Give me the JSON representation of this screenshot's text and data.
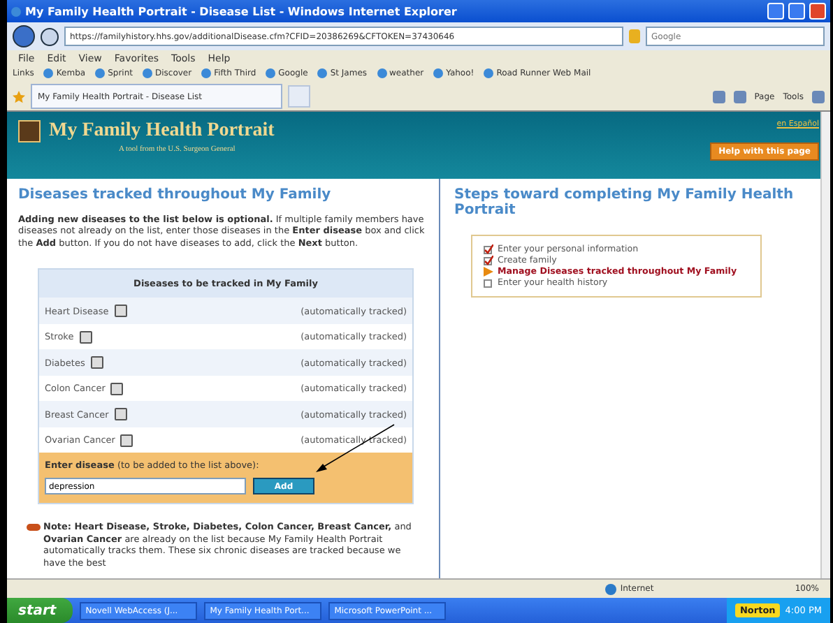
{
  "window": {
    "title": "My Family Health Portrait - Disease List - Windows Internet Explorer"
  },
  "address": {
    "url": "https://familyhistory.hhs.gov/additionalDisease.cfm?CFID=20386269&CFTOKEN=37430646",
    "search_placeholder": "Google"
  },
  "menu": [
    "File",
    "Edit",
    "View",
    "Favorites",
    "Tools",
    "Help"
  ],
  "links": {
    "label": "Links",
    "items": [
      "Kemba",
      "Sprint",
      "Discover",
      "Fifth Third",
      "Google",
      "St James",
      "weather",
      "Yahoo!",
      "Road Runner Web Mail"
    ]
  },
  "tab": {
    "label": "My Family Health Portrait - Disease List"
  },
  "toolbar": [
    "Page",
    "Tools"
  ],
  "header": {
    "title": "My Family Health Portrait",
    "subtitle": "A tool from the U.S. Surgeon General",
    "language_link": "en Español",
    "help_button": "Help with this page"
  },
  "left": {
    "heading": "Diseases tracked throughout My Family",
    "intro": "**Adding new diseases to the list below is optional.** If multiple family members have diseases not already on the list, enter those diseases in the **Enter disease** box and click the **Add** button. If you do not have diseases to add, click the **Next** button.",
    "table_header": "Diseases to be tracked in My Family",
    "rows": [
      {
        "name": "Heart Disease",
        "status": "(automatically tracked)"
      },
      {
        "name": "Stroke",
        "status": "(automatically tracked)"
      },
      {
        "name": "Diabetes",
        "status": "(automatically tracked)"
      },
      {
        "name": "Colon Cancer",
        "status": "(automatically tracked)"
      },
      {
        "name": "Breast Cancer",
        "status": "(automatically tracked)"
      },
      {
        "name": "Ovarian Cancer",
        "status": "(automatically tracked)"
      }
    ],
    "enter_label": "**Enter disease** (to be added to the list above):",
    "input_value": "depression",
    "add_button": "Add",
    "note": "**Note: Heart Disease, Stroke, Diabetes, Colon Cancer, Breast Cancer,** and **Ovarian Cancer** are already on the list because My Family Health Portrait automatically tracks them. These six chronic diseases are tracked because we have the best"
  },
  "right": {
    "heading": "Steps toward completing My Family Health Portrait",
    "steps": [
      {
        "label": "Enter your personal information",
        "kind": "done"
      },
      {
        "label": "Create family",
        "kind": "done"
      },
      {
        "label": "Manage Diseases tracked throughout My Family",
        "kind": "current"
      },
      {
        "label": "Enter your health history",
        "kind": "todo"
      }
    ]
  },
  "status_bar": {
    "zone": "Internet",
    "zoom": "100%"
  },
  "taskbar": {
    "start": "start",
    "tasks": [
      "Novell WebAccess (J...",
      "My Family Health Port...",
      "Microsoft PowerPoint ..."
    ],
    "tray_label": "Norton",
    "clock": "4:00 PM"
  }
}
